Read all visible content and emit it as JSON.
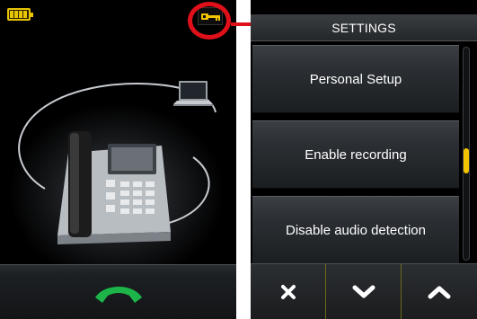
{
  "settings": {
    "title": "SETTINGS",
    "items": [
      {
        "label": "Personal Setup"
      },
      {
        "label": "Enable recording"
      },
      {
        "label": "Disable audio detection"
      }
    ]
  },
  "icons": {
    "battery": "battery-full-icon",
    "key": "key-icon",
    "laptop": "laptop-icon",
    "desk_phone": "desk-phone-icon",
    "call": "phone-handset-icon",
    "cancel": "close-icon",
    "down": "chevron-down-icon",
    "up": "chevron-up-icon"
  },
  "colors": {
    "accent_yellow": "#f2c400",
    "call_green": "#1db54a",
    "annotation_red": "#e0101a"
  }
}
